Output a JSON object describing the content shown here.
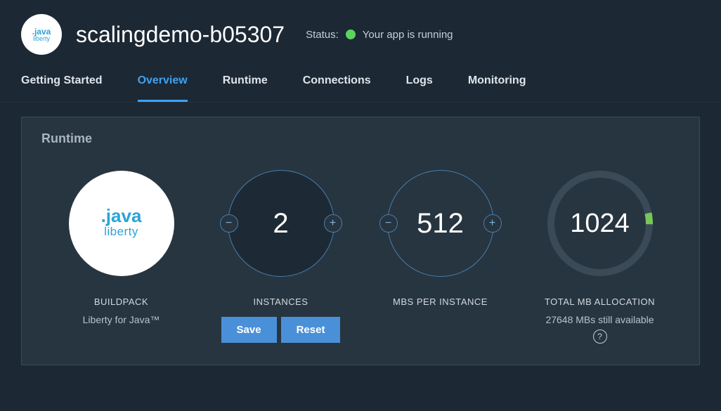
{
  "header": {
    "app_name": "scalingdemo-b05307",
    "status_label": "Status:",
    "status_text": "Your app is running",
    "status_color": "#5cd35c",
    "icon_text_top": ".java",
    "icon_text_bottom": "liberty"
  },
  "tabs": [
    {
      "label": "Getting Started",
      "active": false
    },
    {
      "label": "Overview",
      "active": true
    },
    {
      "label": "Runtime",
      "active": false
    },
    {
      "label": "Connections",
      "active": false
    },
    {
      "label": "Logs",
      "active": false
    },
    {
      "label": "Monitoring",
      "active": false
    }
  ],
  "panel": {
    "title": "Runtime",
    "buildpack": {
      "label": "BUILDPACK",
      "name": "Liberty for Java™",
      "logo_top": ".java",
      "logo_bottom": "liberty"
    },
    "instances": {
      "label": "INSTANCES",
      "value": "2",
      "save_label": "Save",
      "reset_label": "Reset"
    },
    "mbs": {
      "label": "MBS PER INSTANCE",
      "value": "512"
    },
    "allocation": {
      "label": "TOTAL MB ALLOCATION",
      "value": "1024",
      "available": "27648 MBs still available",
      "used_fraction": 0.036
    }
  },
  "colors": {
    "accent": "#3ea2f2",
    "gauge_track": "#3b4a57",
    "gauge_fill": "#77c858"
  }
}
